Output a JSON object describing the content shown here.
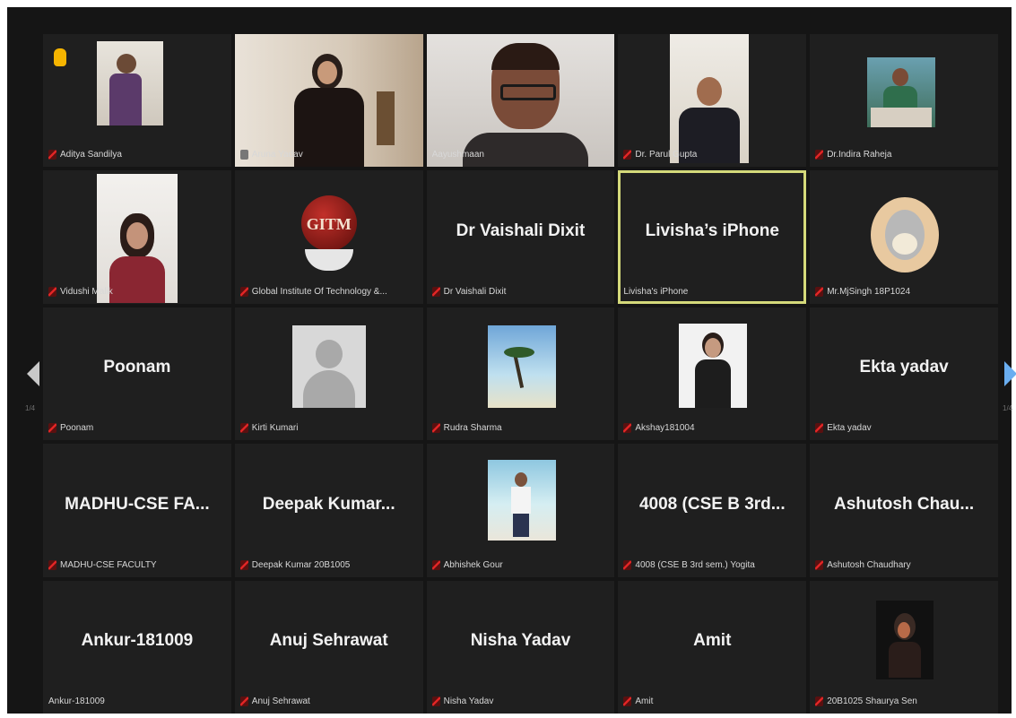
{
  "page_indicator": {
    "left": "1/4",
    "right": "1/4"
  },
  "tiles": [
    {
      "label": "Aditya Sandilya"
    },
    {
      "label": "Aruna Yadav"
    },
    {
      "label": "Aayushmaan"
    },
    {
      "label": "Dr. Parul Gupta"
    },
    {
      "label": "Dr.Indira Raheja"
    },
    {
      "label": "Vidushi Malik"
    },
    {
      "label": "Global Institute Of Technology &..."
    },
    {
      "center": "Dr Vaishali Dixit",
      "label": "Dr Vaishali Dixit"
    },
    {
      "center": "Livisha’s iPhone",
      "label": "Livisha's iPhone"
    },
    {
      "label": "Mr.MjSingh 18P1024"
    },
    {
      "center": "Poonam",
      "label": "Poonam"
    },
    {
      "label": "Kirti Kumari"
    },
    {
      "label": "Rudra Sharma"
    },
    {
      "label": "Akshay181004"
    },
    {
      "center": "Ekta yadav",
      "label": "Ekta yadav"
    },
    {
      "center": "MADHU-CSE FA...",
      "label": "MADHU-CSE FACULTY"
    },
    {
      "center": "Deepak Kumar...",
      "label": "Deepak Kumar 20B1005"
    },
    {
      "label": "Abhishek Gour"
    },
    {
      "center": "4008 (CSE B 3rd...",
      "label": "4008 (CSE B 3rd sem.) Yogita"
    },
    {
      "center": "Ashutosh Chau...",
      "label": "Ashutosh Chaudhary"
    },
    {
      "center": "Ankur-181009",
      "label": "Ankur-181009"
    },
    {
      "center": "Anuj Sehrawat",
      "label": "Anuj Sehrawat"
    },
    {
      "center": "Nisha Yadav",
      "label": "Nisha Yadav"
    },
    {
      "center": "Amit",
      "label": "Amit"
    },
    {
      "label": "20B1025 Shaurya Sen"
    }
  ]
}
